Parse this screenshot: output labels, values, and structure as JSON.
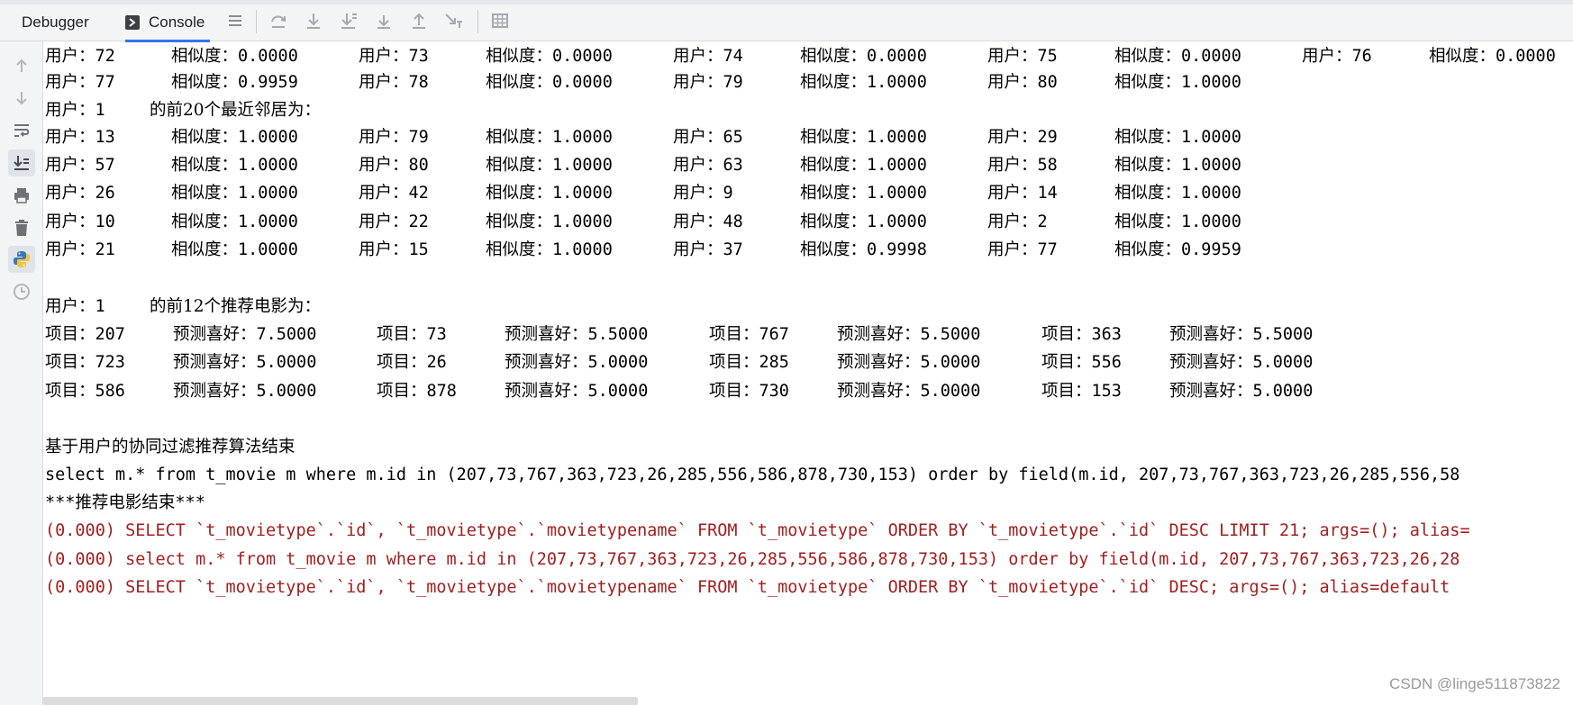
{
  "tabs": {
    "debugger": "Debugger",
    "console": "Console"
  },
  "toolbar_icons": [
    "menu-icon",
    "step-over-icon",
    "step-into-icon",
    "force-step-into-icon",
    "step-down-icon",
    "step-out-icon",
    "run-to-cursor-icon",
    "table-icon"
  ],
  "sidebar_icons": [
    "up-arrow-icon",
    "down-arrow-icon",
    "soft-wrap-icon",
    "scroll-to-end-icon",
    "print-icon",
    "trash-icon",
    "python-console-icon",
    "history-icon"
  ],
  "sim_rows_top": [
    [
      "用户：72",
      "相似度：0.0000",
      "用户：73",
      "相似度：0.0000",
      "用户：74",
      "相似度：0.0000",
      "用户：75",
      "相似度：0.0000",
      "用户：76",
      "相似度：0.0000"
    ],
    [
      "用户：77",
      "相似度：0.9959",
      "用户：78",
      "相似度：0.0000",
      "用户：79",
      "相似度：1.0000",
      "用户：80",
      "相似度：1.0000"
    ]
  ],
  "neighbors_header": [
    "用户：1",
    "的前20个最近邻居为："
  ],
  "neighbor_rows": [
    [
      "用户：13",
      "相似度：1.0000",
      "用户：79",
      "相似度：1.0000",
      "用户：65",
      "相似度：1.0000",
      "用户：29",
      "相似度：1.0000"
    ],
    [
      "用户：57",
      "相似度：1.0000",
      "用户：80",
      "相似度：1.0000",
      "用户：63",
      "相似度：1.0000",
      "用户：58",
      "相似度：1.0000"
    ],
    [
      "用户：26",
      "相似度：1.0000",
      "用户：42",
      "相似度：1.0000",
      "用户：9",
      "相似度：1.0000",
      "用户：14",
      "相似度：1.0000"
    ],
    [
      "用户：10",
      "相似度：1.0000",
      "用户：22",
      "相似度：1.0000",
      "用户：48",
      "相似度：1.0000",
      "用户：2",
      "相似度：1.0000"
    ],
    [
      "用户：21",
      "相似度：1.0000",
      "用户：15",
      "相似度：1.0000",
      "用户：37",
      "相似度：0.9998",
      "用户：77",
      "相似度：0.9959"
    ]
  ],
  "recommend_header": [
    "用户：1",
    "的前12个推荐电影为："
  ],
  "recommend_rows": [
    [
      "项目：207",
      "预测喜好：7.5000",
      "项目：73",
      "预测喜好：5.5000",
      "项目：767",
      "预测喜好：5.5000",
      "项目：363",
      "预测喜好：5.5000"
    ],
    [
      "项目：723",
      "预测喜好：5.0000",
      "项目：26",
      "预测喜好：5.0000",
      "项目：285",
      "预测喜好：5.0000",
      "项目：556",
      "预测喜好：5.0000"
    ],
    [
      "项目：586",
      "预测喜好：5.0000",
      "项目：878",
      "预测喜好：5.0000",
      "项目：730",
      "预测喜好：5.0000",
      "项目：153",
      "预测喜好：5.0000"
    ]
  ],
  "algo_end": "基于用户的协同过滤推荐算法结束",
  "sql_select": "select m.* from t_movie m where m.id in (207,73,767,363,723,26,285,556,586,878,730,153) order by field(m.id, 207,73,767,363,723,26,285,556,58",
  "recommend_end": "***推荐电影结束***",
  "log_lines": [
    "(0.000) SELECT `t_movietype`.`id`, `t_movietype`.`movietypename` FROM `t_movietype` ORDER BY `t_movietype`.`id` DESC LIMIT 21; args=(); alias=",
    "(0.000) select m.* from t_movie m where m.id in (207,73,767,363,723,26,285,556,586,878,730,153) order by field(m.id, 207,73,767,363,723,26,28",
    "(0.000) SELECT `t_movietype`.`id`, `t_movietype`.`movietypename` FROM `t_movietype` ORDER BY `t_movietype`.`id` DESC; args=(); alias=default"
  ],
  "watermark": "CSDN @linge511873822"
}
